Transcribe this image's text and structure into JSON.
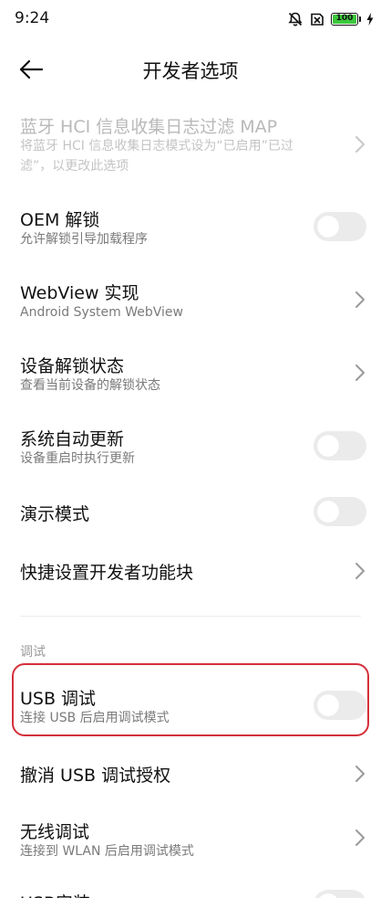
{
  "status_bar": {
    "time": "9:24",
    "battery_level": "100",
    "battery_color": "#3cc83c",
    "icons": [
      "mute-icon",
      "no-sim-icon",
      "battery-icon",
      "charging-icon"
    ]
  },
  "header": {
    "title": "开发者选项",
    "back_icon": "arrow-left-icon"
  },
  "rows": {
    "bt_hci": {
      "title": "蓝牙 HCI 信息收集日志过滤 MAP",
      "sub_line1": "将蓝牙 HCI 信息收集日志模式设为“已启用”已过",
      "sub_line2": "滤”，以更改此选项",
      "control": "chevron",
      "disabled": true
    },
    "oem_unlock": {
      "title": "OEM 解锁",
      "sub": "允许解锁引导加载程序",
      "control": "toggle",
      "on": false
    },
    "webview": {
      "title": "WebView 实现",
      "sub": "Android System WebView",
      "control": "chevron"
    },
    "device_lock": {
      "title": "设备解锁状态",
      "sub": "查看当前设备的解锁状态",
      "control": "chevron"
    },
    "auto_update": {
      "title": "系统自动更新",
      "sub": "设备重启时执行更新",
      "control": "toggle",
      "on": false
    },
    "demo_mode": {
      "title": "演示模式",
      "control": "toggle",
      "on": false
    },
    "quick_tiles": {
      "title": "快捷设置开发者功能块",
      "control": "chevron"
    },
    "usb_debug": {
      "title": "USB 调试",
      "sub": "连接 USB 后启用调试模式",
      "control": "toggle",
      "on": false
    },
    "revoke_usb": {
      "title": "撤消 USB 调试授权",
      "control": "chevron"
    },
    "wireless_debug": {
      "title": "无线调试",
      "sub": "连接到 WLAN 后启用调试模式",
      "control": "chevron"
    },
    "usb_install": {
      "title": "USB安装",
      "control": "toggle",
      "on": false
    }
  },
  "section": {
    "debug_label": "调试"
  },
  "highlight_color": "#d4303a"
}
